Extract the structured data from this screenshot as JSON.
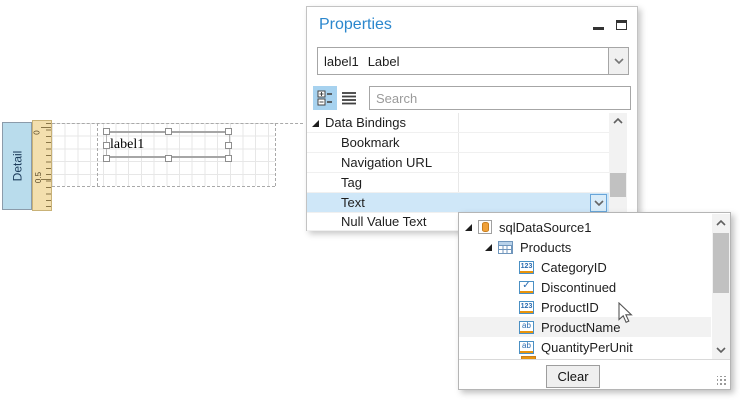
{
  "designer": {
    "band_label": "Detail",
    "ruler_marks": [
      "0",
      "0.5"
    ],
    "label_control": {
      "text": "label1"
    }
  },
  "properties_panel": {
    "title": "Properties",
    "window_buttons": [
      "minimize",
      "maximize"
    ],
    "object_selector": {
      "name": "label1",
      "type": "Label"
    },
    "toolbar": {
      "categorized_button": "categorized-view",
      "alphabetical_button": "alphabetical-view",
      "search_placeholder": "Search"
    },
    "grid": {
      "category": "Data Bindings",
      "rows": [
        {
          "label": "Bookmark",
          "value": ""
        },
        {
          "label": "Navigation URL",
          "value": ""
        },
        {
          "label": "Tag",
          "value": ""
        },
        {
          "label": "Text",
          "value": "",
          "selected": true
        },
        {
          "label": "Null Value Text",
          "value": ""
        }
      ]
    }
  },
  "field_list_popup": {
    "tree": [
      {
        "label": "sqlDataSource1",
        "icon": "datasource-icon",
        "level": 0,
        "expanded": true
      },
      {
        "label": "Products",
        "icon": "table-icon",
        "level": 1,
        "expanded": true
      },
      {
        "label": "CategoryID",
        "icon": "number-field-icon",
        "level": 2
      },
      {
        "label": "Discontinued",
        "icon": "boolean-field-icon",
        "level": 2
      },
      {
        "label": "ProductID",
        "icon": "number-field-icon",
        "level": 2
      },
      {
        "label": "ProductName",
        "icon": "text-field-icon",
        "level": 2,
        "hovered": true
      },
      {
        "label": "QuantityPerUnit",
        "icon": "text-field-icon",
        "level": 2
      }
    ],
    "clear_button": "Clear"
  },
  "colors": {
    "accent_blue": "#2b87cd",
    "row_selection": "#cfe7f8",
    "toolbar_selected": "#a7d2ef",
    "band_tab_fill": "#b9dcec",
    "ruler_fill": "#f3dfae",
    "field_icon_orange": "#e8930c",
    "field_icon_blue": "#4a90c4"
  }
}
